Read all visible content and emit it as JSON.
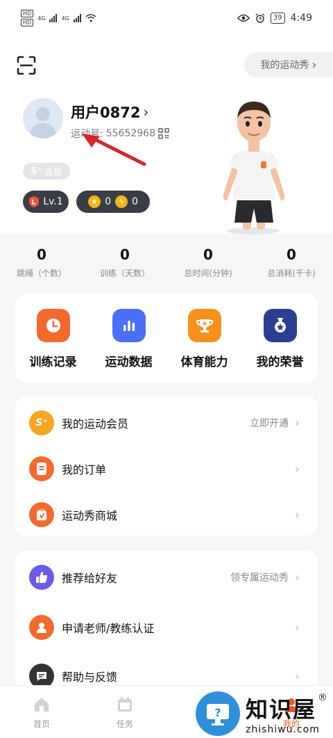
{
  "status_bar": {
    "hd1": "HD",
    "hd2": "HD",
    "net1": "4G",
    "net2": "4G",
    "battery": "39",
    "time": "4:49"
  },
  "header": {
    "show_button_label": "我的运动秀",
    "chevron": "›"
  },
  "profile": {
    "username": "用户0872",
    "sport_id_label": "运动号:",
    "sport_id_value": "55652968",
    "member_label": "会员",
    "member_prefix": "S⁺",
    "level": "Lv.1",
    "coin_count_1": "0",
    "coin_count_2": "0"
  },
  "stats": [
    {
      "value": "0",
      "label": "跳绳（个数）"
    },
    {
      "value": "0",
      "label": "训练（天数）"
    },
    {
      "value": "0",
      "label": "总时间(分钟)"
    },
    {
      "value": "0",
      "label": "总消耗(千卡)"
    }
  ],
  "features": [
    {
      "label": "训练记录",
      "icon": "clock-icon",
      "color": "#f26a2e"
    },
    {
      "label": "运动数据",
      "icon": "bar-chart-icon",
      "color": "#4b6ff5"
    },
    {
      "label": "体育能力",
      "icon": "trophy-icon",
      "color": "#f5921e"
    },
    {
      "label": "我的荣誉",
      "icon": "medal-icon",
      "color": "#2d3f8f"
    }
  ],
  "menu_group_1": [
    {
      "label": "我的运动会员",
      "right_text": "立即开通",
      "icon": "splus-icon",
      "color": "#f5a623"
    },
    {
      "label": "我的订单",
      "right_text": "",
      "icon": "order-icon",
      "color": "#f26a2e"
    },
    {
      "label": "运动秀商城",
      "right_text": "",
      "icon": "shop-icon",
      "color": "#f26a2e"
    }
  ],
  "menu_group_2": [
    {
      "label": "推荐给好友",
      "right_text": "领专属运动秀",
      "icon": "thumbs-up-icon",
      "color": "#6b5ce7"
    },
    {
      "label": "申请老师/教练认证",
      "right_text": "",
      "icon": "person-icon",
      "color": "#f26a2e"
    },
    {
      "label": "帮助与反馈",
      "right_text": "",
      "icon": "chat-icon",
      "color": "#333333"
    }
  ],
  "tabbar": [
    {
      "label": "首页",
      "icon": "home-icon"
    },
    {
      "label": "任务",
      "icon": "calendar-icon"
    },
    {
      "label": "",
      "icon": "device-icon"
    },
    {
      "label": "我的",
      "icon": "profile-icon"
    }
  ],
  "watermark": {
    "cn": "知识屋",
    "en": "zhishiwu.com",
    "reg": "®"
  }
}
